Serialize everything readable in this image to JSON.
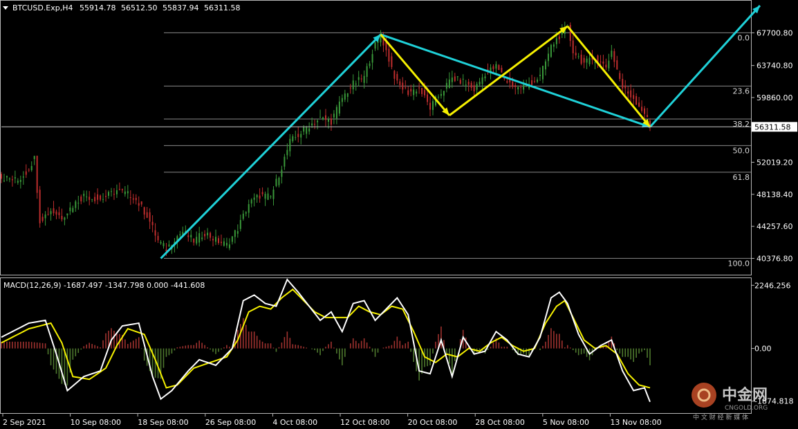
{
  "chart_data": {
    "type": "candlestick",
    "title": "BTCUSD.Exp,H4",
    "ohlc": {
      "open": "55914.78",
      "high": "56512.50",
      "low": "55837.94",
      "close": "56311.58"
    },
    "y_ticks": [
      "67700.80",
      "63740.80",
      "59860.00",
      "52019.20",
      "48138.40",
      "44257.60",
      "40376.80"
    ],
    "ylim": [
      38400,
      70000
    ],
    "current_price": {
      "value": 56311.58,
      "label": "56311.58"
    },
    "x_ticks": [
      "2 Sep 2021",
      "10 Sep 08:00",
      "18 Sep 08:00",
      "26 Sep 08:00",
      "4 Oct 08:00",
      "12 Oct 08:00",
      "20 Oct 08:00",
      "28 Oct 08:00",
      "5 Nov 08:00",
      "13 Nov 08:00"
    ],
    "fibonacci": {
      "high": 67700.8,
      "low": 40376.8,
      "levels": [
        {
          "label": "0.0",
          "ratio": 0.0
        },
        {
          "label": "23.6",
          "ratio": 0.236
        },
        {
          "label": "38.2",
          "ratio": 0.382
        },
        {
          "label": "50.0",
          "ratio": 0.5
        },
        {
          "label": "61.8",
          "ratio": 0.618
        },
        {
          "label": "100.0",
          "ratio": 1.0
        }
      ]
    },
    "price_path": [
      [
        0,
        50200
      ],
      [
        6,
        49800
      ],
      [
        9,
        50800
      ],
      [
        12,
        52500
      ],
      [
        14,
        45000
      ],
      [
        18,
        46200
      ],
      [
        22,
        45400
      ],
      [
        26,
        46800
      ],
      [
        30,
        48000
      ],
      [
        36,
        47500
      ],
      [
        42,
        48600
      ],
      [
        48,
        47900
      ],
      [
        53,
        45600
      ],
      [
        57,
        42500
      ],
      [
        60,
        41500
      ],
      [
        63,
        42800
      ],
      [
        66,
        43600
      ],
      [
        70,
        42500
      ],
      [
        74,
        43500
      ],
      [
        78,
        42600
      ],
      [
        82,
        42000
      ],
      [
        86,
        44000
      ],
      [
        90,
        47000
      ],
      [
        94,
        48000
      ],
      [
        98,
        47800
      ],
      [
        102,
        51500
      ],
      [
        105,
        54500
      ],
      [
        108,
        55300
      ],
      [
        112,
        56500
      ],
      [
        116,
        57300
      ],
      [
        120,
        57000
      ],
      [
        124,
        59800
      ],
      [
        128,
        61500
      ],
      [
        132,
        62300
      ],
      [
        135,
        65500
      ],
      [
        138,
        67500
      ],
      [
        141,
        64500
      ],
      [
        144,
        61500
      ],
      [
        148,
        60500
      ],
      [
        152,
        61000
      ],
      [
        156,
        58600
      ],
      [
        160,
        60500
      ],
      [
        164,
        62200
      ],
      [
        168,
        61800
      ],
      [
        172,
        60800
      ],
      [
        176,
        62800
      ],
      [
        180,
        63600
      ],
      [
        184,
        61800
      ],
      [
        188,
        61000
      ],
      [
        192,
        61500
      ],
      [
        196,
        62400
      ],
      [
        200,
        66000
      ],
      [
        204,
        67800
      ],
      [
        206,
        68200
      ],
      [
        208,
        65500
      ],
      [
        212,
        64000
      ],
      [
        216,
        64600
      ],
      [
        220,
        63600
      ],
      [
        222,
        65500
      ],
      [
        226,
        61000
      ],
      [
        230,
        59800
      ],
      [
        234,
        58000
      ],
      [
        236,
        56300
      ]
    ],
    "x_count": 237,
    "macd": {
      "label": "MACD(12,26,9) -1687.497 -1347.798 0.000 -441.608",
      "y_ticks": [
        "2246.256",
        "0.00",
        "-1874.818"
      ],
      "ylim": [
        -2300,
        2500
      ],
      "macd_line": [
        [
          0,
          400
        ],
        [
          10,
          900
        ],
        [
          16,
          1000
        ],
        [
          20,
          -200
        ],
        [
          24,
          -1500
        ],
        [
          30,
          -1000
        ],
        [
          36,
          -800
        ],
        [
          40,
          300
        ],
        [
          44,
          800
        ],
        [
          50,
          900
        ],
        [
          55,
          -1000
        ],
        [
          58,
          -1800
        ],
        [
          62,
          -1500
        ],
        [
          68,
          -800
        ],
        [
          72,
          -400
        ],
        [
          78,
          -600
        ],
        [
          84,
          0
        ],
        [
          88,
          1700
        ],
        [
          92,
          1900
        ],
        [
          96,
          1600
        ],
        [
          100,
          1500
        ],
        [
          104,
          2450
        ],
        [
          108,
          2000
        ],
        [
          112,
          1500
        ],
        [
          116,
          1000
        ],
        [
          120,
          1300
        ],
        [
          124,
          600
        ],
        [
          128,
          1600
        ],
        [
          132,
          1700
        ],
        [
          136,
          1000
        ],
        [
          140,
          1400
        ],
        [
          144,
          1800
        ],
        [
          148,
          1200
        ],
        [
          152,
          -800
        ],
        [
          156,
          -900
        ],
        [
          160,
          300
        ],
        [
          164,
          -1000
        ],
        [
          168,
          400
        ],
        [
          172,
          -200
        ],
        [
          176,
          -100
        ],
        [
          180,
          600
        ],
        [
          184,
          300
        ],
        [
          188,
          -200
        ],
        [
          192,
          -300
        ],
        [
          196,
          400
        ],
        [
          200,
          1800
        ],
        [
          203,
          2000
        ],
        [
          206,
          1600
        ],
        [
          210,
          500
        ],
        [
          214,
          -200
        ],
        [
          218,
          100
        ],
        [
          222,
          300
        ],
        [
          226,
          -800
        ],
        [
          230,
          -1500
        ],
        [
          234,
          -1400
        ],
        [
          236,
          -1900
        ]
      ],
      "signal_line": [
        [
          0,
          200
        ],
        [
          10,
          700
        ],
        [
          18,
          900
        ],
        [
          22,
          200
        ],
        [
          26,
          -1000
        ],
        [
          32,
          -1100
        ],
        [
          38,
          -700
        ],
        [
          42,
          100
        ],
        [
          46,
          700
        ],
        [
          52,
          500
        ],
        [
          56,
          -400
        ],
        [
          60,
          -1400
        ],
        [
          64,
          -1300
        ],
        [
          70,
          -700
        ],
        [
          76,
          -500
        ],
        [
          82,
          -300
        ],
        [
          86,
          300
        ],
        [
          90,
          1300
        ],
        [
          94,
          1500
        ],
        [
          98,
          1400
        ],
        [
          102,
          1800
        ],
        [
          106,
          2100
        ],
        [
          110,
          1700
        ],
        [
          114,
          1300
        ],
        [
          118,
          1100
        ],
        [
          122,
          1100
        ],
        [
          126,
          1100
        ],
        [
          130,
          1500
        ],
        [
          134,
          1300
        ],
        [
          138,
          1200
        ],
        [
          142,
          1500
        ],
        [
          146,
          1400
        ],
        [
          150,
          600
        ],
        [
          154,
          -300
        ],
        [
          158,
          -500
        ],
        [
          162,
          -200
        ],
        [
          166,
          -300
        ],
        [
          170,
          0
        ],
        [
          174,
          -100
        ],
        [
          178,
          200
        ],
        [
          182,
          400
        ],
        [
          186,
          100
        ],
        [
          190,
          -100
        ],
        [
          194,
          0
        ],
        [
          198,
          900
        ],
        [
          202,
          1500
        ],
        [
          205,
          1700
        ],
        [
          208,
          1100
        ],
        [
          212,
          300
        ],
        [
          216,
          0
        ],
        [
          220,
          100
        ],
        [
          224,
          -200
        ],
        [
          228,
          -900
        ],
        [
          232,
          -1300
        ],
        [
          236,
          -1400
        ]
      ]
    },
    "annotations": [
      {
        "color": "#1fd1d8",
        "points": [
          [
            58,
            40376.8
          ],
          [
            138,
            67500
          ]
        ]
      },
      {
        "color": "#1fd1d8",
        "points": [
          [
            138,
            67500
          ],
          [
            236,
            56300
          ]
        ]
      },
      {
        "color": "#1fd1d8",
        "points": [
          [
            236,
            56300
          ],
          [
            276,
            71000
          ]
        ]
      },
      {
        "color": "#f5f000",
        "points": [
          [
            138,
            67500
          ],
          [
            163,
            57700
          ]
        ]
      },
      {
        "color": "#f5f000",
        "points": [
          [
            163,
            57700
          ],
          [
            206,
            68500
          ]
        ]
      },
      {
        "color": "#f5f000",
        "points": [
          [
            206,
            68500
          ],
          [
            236,
            56300
          ]
        ]
      }
    ]
  },
  "watermark": {
    "brand": "中金网",
    "domain": "CNGOLD.ORG",
    "sub": "中 文 财 经 新 媒 体"
  },
  "colors": {
    "bull": "#3a9a3a",
    "bear": "#c02e2e",
    "macd": "#ffffff",
    "signal": "#f5f000",
    "hist_pos": "#a0322f",
    "hist_neg": "#4f7a2e",
    "grid": "#8a8a8a"
  }
}
